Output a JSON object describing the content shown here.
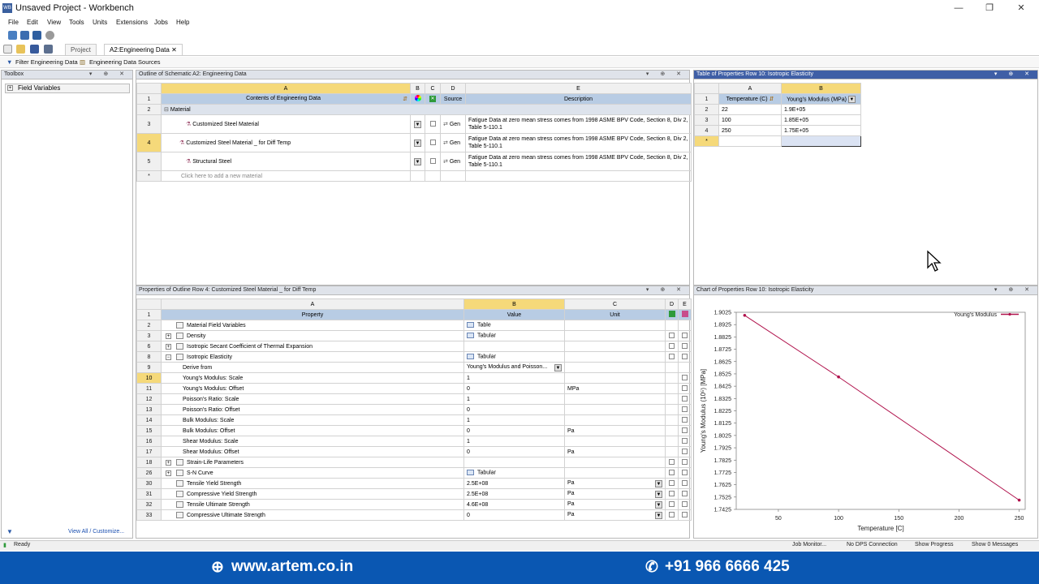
{
  "window": {
    "title": "Unsaved Project - Workbench",
    "app_icon": "WB",
    "minimize": "—",
    "maximize": "❐",
    "close": "✕"
  },
  "menu": [
    "File",
    "Edit",
    "View",
    "Tools",
    "Units",
    "Extensions",
    "Jobs",
    "Help"
  ],
  "tabs": [
    {
      "label": "Project"
    },
    {
      "label": "A2:Engineering Data"
    }
  ],
  "filterbar": {
    "filter": "Filter Engineering Data",
    "sources": "Engineering Data Sources"
  },
  "toolbox": {
    "title": "Toolbox",
    "item": "Field Variables",
    "footer_link": "View All / Customize..."
  },
  "outline": {
    "title": "Outline of Schematic A2: Engineering Data",
    "cols": [
      "A",
      "B",
      "C",
      "D",
      "E"
    ],
    "header": {
      "contents": "Contents of Engineering Data",
      "source": "Source",
      "description": "Description"
    },
    "group": "Material",
    "rows": [
      {
        "n": "3",
        "name": "Customized Steel Material",
        "src": "Gen",
        "desc": "Fatigue Data at zero mean stress comes from 1998 ASME BPV Code, Section 8, Div 2, Table 5-110.1"
      },
      {
        "n": "4",
        "name": "Customized Steel Material _ for Diff Temp",
        "src": "Gen",
        "desc": "Fatigue Data at zero mean stress comes from 1998 ASME BPV Code, Section 8, Div 2, Table 5-110.1"
      },
      {
        "n": "5",
        "name": "Structural Steel",
        "src": "Gen",
        "desc": "Fatigue Data at zero mean stress comes from 1998 ASME BPV Code, Section 8, Div 2, Table 5-110.1"
      }
    ],
    "add_row": "Click here to add a new material",
    "rownums": [
      "1",
      "2",
      "*"
    ]
  },
  "props_table": {
    "title": "Table of Properties Row 10: Isotropic Elasticity",
    "cols": [
      "A",
      "B"
    ],
    "header": [
      "Temperature (C)",
      "Young's Modulus (MPa)"
    ],
    "rows": [
      {
        "n": "2",
        "t": "22",
        "e": "1.9E+05"
      },
      {
        "n": "3",
        "t": "100",
        "e": "1.85E+05"
      },
      {
        "n": "4",
        "t": "250",
        "e": "1.75E+05"
      }
    ],
    "rownums": [
      "1",
      "*"
    ]
  },
  "properties": {
    "title": "Properties of Outline Row 4: Customized Steel Material _ for Diff Temp",
    "cols": [
      "A",
      "B",
      "C",
      "D",
      "E"
    ],
    "header": {
      "property": "Property",
      "value": "Value",
      "unit": "Unit"
    },
    "rows": [
      {
        "n": "2",
        "p": "Material Field Variables",
        "v": "Table",
        "u": "",
        "lvl": 0,
        "exp": "",
        "tbl": true,
        "chk": false
      },
      {
        "n": "3",
        "p": "Density",
        "v": "Tabular",
        "u": "",
        "lvl": 0,
        "exp": "+",
        "tbl": true,
        "chk": true
      },
      {
        "n": "6",
        "p": "Isotropic Secant Coefficient of Thermal Expansion",
        "v": "",
        "u": "",
        "lvl": 0,
        "exp": "+",
        "tbl": false,
        "chk": true
      },
      {
        "n": "8",
        "p": "Isotropic Elasticity",
        "v": "Tabular",
        "u": "",
        "lvl": 0,
        "exp": "−",
        "tbl": true,
        "chk": true
      },
      {
        "n": "9",
        "p": "Derive from",
        "v": "Young's Modulus and Poisson...",
        "u": "",
        "lvl": 1,
        "exp": "",
        "tbl": false,
        "chk": false,
        "dd": true
      },
      {
        "n": "10",
        "p": "Young's Modulus: Scale",
        "v": "1",
        "u": "",
        "lvl": 1,
        "exp": "",
        "tbl": false,
        "chk": false,
        "sel": true
      },
      {
        "n": "11",
        "p": "Young's Modulus: Offset",
        "v": "0",
        "u": "MPa",
        "lvl": 1,
        "exp": "",
        "tbl": false,
        "chk": false
      },
      {
        "n": "12",
        "p": "Poisson's Ratio: Scale",
        "v": "1",
        "u": "",
        "lvl": 1,
        "exp": "",
        "tbl": false,
        "chk": false
      },
      {
        "n": "13",
        "p": "Poisson's Ratio: Offset",
        "v": "0",
        "u": "",
        "lvl": 1,
        "exp": "",
        "tbl": false,
        "chk": false
      },
      {
        "n": "14",
        "p": "Bulk Modulus: Scale",
        "v": "1",
        "u": "",
        "lvl": 1,
        "exp": "",
        "tbl": false,
        "chk": false
      },
      {
        "n": "15",
        "p": "Bulk Modulus: Offset",
        "v": "0",
        "u": "Pa",
        "lvl": 1,
        "exp": "",
        "tbl": false,
        "chk": false
      },
      {
        "n": "16",
        "p": "Shear Modulus: Scale",
        "v": "1",
        "u": "",
        "lvl": 1,
        "exp": "",
        "tbl": false,
        "chk": false
      },
      {
        "n": "17",
        "p": "Shear Modulus: Offset",
        "v": "0",
        "u": "Pa",
        "lvl": 1,
        "exp": "",
        "tbl": false,
        "chk": false
      },
      {
        "n": "18",
        "p": "Strain-Life Parameters",
        "v": "",
        "u": "",
        "lvl": 0,
        "exp": "+",
        "tbl": false,
        "chk": true
      },
      {
        "n": "26",
        "p": "S-N Curve",
        "v": "Tabular",
        "u": "",
        "lvl": 0,
        "exp": "+",
        "tbl": true,
        "chk": true
      },
      {
        "n": "30",
        "p": "Tensile Yield Strength",
        "v": "2.5E+08",
        "u": "Pa",
        "lvl": 0,
        "exp": "",
        "tbl": false,
        "chk": true,
        "udd": true
      },
      {
        "n": "31",
        "p": "Compressive Yield Strength",
        "v": "2.5E+08",
        "u": "Pa",
        "lvl": 0,
        "exp": "",
        "tbl": false,
        "chk": true,
        "udd": true
      },
      {
        "n": "32",
        "p": "Tensile Ultimate Strength",
        "v": "4.6E+08",
        "u": "Pa",
        "lvl": 0,
        "exp": "",
        "tbl": false,
        "chk": true,
        "udd": true
      },
      {
        "n": "33",
        "p": "Compressive Ultimate Strength",
        "v": "0",
        "u": "Pa",
        "lvl": 0,
        "exp": "",
        "tbl": false,
        "chk": true,
        "udd": true
      }
    ],
    "rownum_header": "1"
  },
  "chart_panel": {
    "title": "Chart of Properties Row 10: Isotropic Elasticity"
  },
  "chart_data": {
    "type": "line",
    "xlabel": "Temperature  [C]",
    "ylabel": "Young's Modulus  (10⁵)  [MPa]",
    "legend": "Young's Modulus",
    "legend_position": "top-right",
    "color": "#b0124c",
    "x": [
      22,
      100,
      250
    ],
    "y": [
      1.9,
      1.85,
      1.75
    ],
    "xlim": [
      22,
      250
    ],
    "ylim": [
      1.7425,
      1.9025
    ],
    "xticks": [
      "50",
      "100",
      "150",
      "200",
      "250"
    ],
    "yticks": [
      "1.9025",
      "1.8925",
      "1.8825",
      "1.8725",
      "1.8625",
      "1.8525",
      "1.8425",
      "1.8325",
      "1.8225",
      "1.8125",
      "1.8025",
      "1.7925",
      "1.7825",
      "1.7725",
      "1.7625",
      "1.7525",
      "1.7425"
    ]
  },
  "status": {
    "ready": "Ready",
    "job_monitor": "Job Monitor...",
    "dps": "No DPS Connection",
    "progress": "Show Progress",
    "messages": "Show 0 Messages"
  },
  "banner": {
    "website": "www.artem.co.in",
    "phone": "+91 966 6666 425"
  }
}
